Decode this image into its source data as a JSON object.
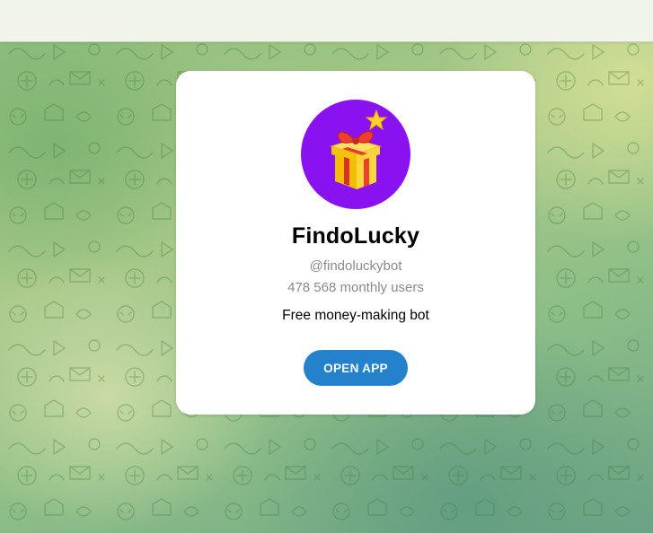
{
  "bot": {
    "name": "FindoLucky",
    "username": "@findoluckybot",
    "monthly_users": "478 568 monthly users",
    "description": "Free money-making bot",
    "avatar_icon": "gift-box-icon",
    "avatar_color": "#8a12f0"
  },
  "actions": {
    "open_app_label": "OPEN APP",
    "button_color": "#2481cc"
  }
}
